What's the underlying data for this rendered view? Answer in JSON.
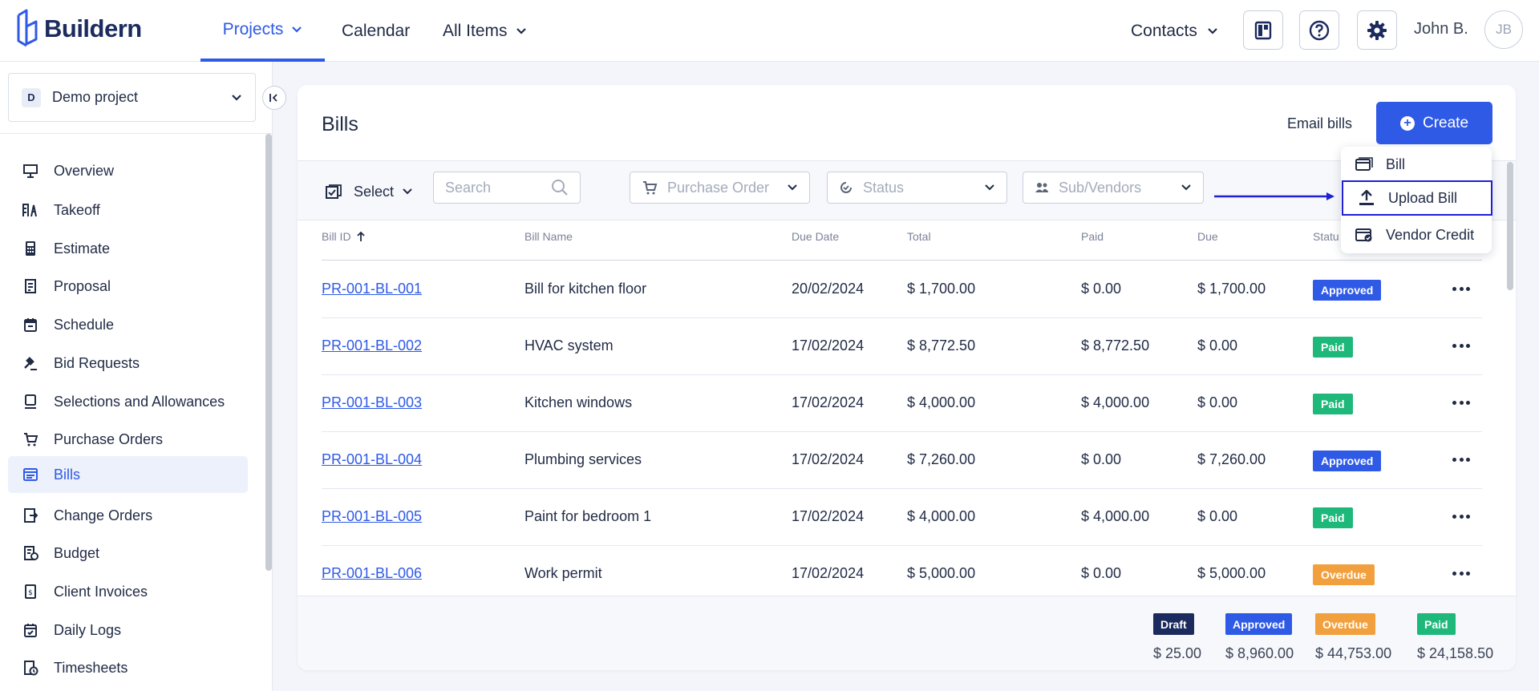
{
  "brand": {
    "name": "Buildern"
  },
  "topnav": {
    "items": [
      {
        "label": "Projects",
        "active": true,
        "has_dropdown": true
      },
      {
        "label": "Calendar",
        "active": false,
        "has_dropdown": false
      },
      {
        "label": "All Items",
        "active": false,
        "has_dropdown": true
      }
    ],
    "contacts_label": "Contacts",
    "user_name": "John B.",
    "user_initials": "JB"
  },
  "sidebar": {
    "project": {
      "badge": "D",
      "name": "Demo project"
    },
    "items": [
      {
        "label": "Overview",
        "icon": "presentation-icon"
      },
      {
        "label": "Takeoff",
        "icon": "takeoff-icon"
      },
      {
        "label": "Estimate",
        "icon": "calculator-icon"
      },
      {
        "label": "Proposal",
        "icon": "proposal-icon"
      },
      {
        "label": "Schedule",
        "icon": "calendar-icon"
      },
      {
        "label": "Bid Requests",
        "icon": "gavel-icon"
      },
      {
        "label": "Selections and Allowances",
        "icon": "selections-icon"
      },
      {
        "label": "Purchase Orders",
        "icon": "cart-icon"
      },
      {
        "label": "Bills",
        "icon": "bills-icon",
        "active": true
      },
      {
        "label": "Change Orders",
        "icon": "change-orders-icon"
      },
      {
        "label": "Budget",
        "icon": "budget-icon"
      },
      {
        "label": "Client Invoices",
        "icon": "invoice-icon"
      },
      {
        "label": "Daily Logs",
        "icon": "daily-log-icon"
      },
      {
        "label": "Timesheets",
        "icon": "timesheet-icon"
      }
    ]
  },
  "page": {
    "title": "Bills",
    "email_bills_label": "Email bills",
    "create_label": "Create"
  },
  "filters": {
    "select_label": "Select",
    "search_placeholder": "Search",
    "purchase_order_placeholder": "Purchase Order",
    "status_placeholder": "Status",
    "vendors_placeholder": "Sub/Vendors"
  },
  "create_menu": {
    "items": [
      {
        "label": "Bill",
        "icon": "bill-icon"
      },
      {
        "label": "Upload Bill",
        "icon": "upload-icon",
        "highlighted": true
      },
      {
        "label": "Vendor Credit",
        "icon": "vendor-credit-icon"
      }
    ]
  },
  "table": {
    "columns": [
      "Bill ID",
      "Bill Name",
      "Due Date",
      "Total",
      "Paid",
      "Due",
      "Statu"
    ],
    "sort_column": "Bill ID",
    "rows": [
      {
        "id": "PR-001-BL-001",
        "name": "Bill for kitchen floor",
        "due_date": "20/02/2024",
        "total": "$ 1,700.00",
        "paid": "$ 0.00",
        "due": "$ 1,700.00",
        "status": "Approved"
      },
      {
        "id": "PR-001-BL-002",
        "name": "HVAC system",
        "due_date": "17/02/2024",
        "total": "$ 8,772.50",
        "paid": "$ 8,772.50",
        "due": "$ 0.00",
        "status": "Paid"
      },
      {
        "id": "PR-001-BL-003",
        "name": "Kitchen windows",
        "due_date": "17/02/2024",
        "total": "$ 4,000.00",
        "paid": "$ 4,000.00",
        "due": "$ 0.00",
        "status": "Paid"
      },
      {
        "id": "PR-001-BL-004",
        "name": "Plumbing services",
        "due_date": "17/02/2024",
        "total": "$ 7,260.00",
        "paid": "$ 0.00",
        "due": "$ 7,260.00",
        "status": "Approved"
      },
      {
        "id": "PR-001-BL-005",
        "name": "Paint for bedroom 1",
        "due_date": "17/02/2024",
        "total": "$ 4,000.00",
        "paid": "$ 4,000.00",
        "due": "$ 0.00",
        "status": "Paid"
      },
      {
        "id": "PR-001-BL-006",
        "name": "Work permit",
        "due_date": "17/02/2024",
        "total": "$ 5,000.00",
        "paid": "$ 0.00",
        "due": "$ 5,000.00",
        "status": "Overdue"
      }
    ]
  },
  "summary": [
    {
      "status": "Draft",
      "amount": "$ 25.00"
    },
    {
      "status": "Approved",
      "amount": "$ 8,960.00"
    },
    {
      "status": "Overdue",
      "amount": "$ 44,753.00"
    },
    {
      "status": "Paid",
      "amount": "$ 24,158.50"
    }
  ],
  "colors": {
    "accent": "#2f5ae6",
    "approved": "#2f5ae6",
    "paid": "#1eb87a",
    "overdue": "#f2a03d",
    "draft": "#1c2b5e",
    "highlight_border": "#1f1fd6"
  }
}
